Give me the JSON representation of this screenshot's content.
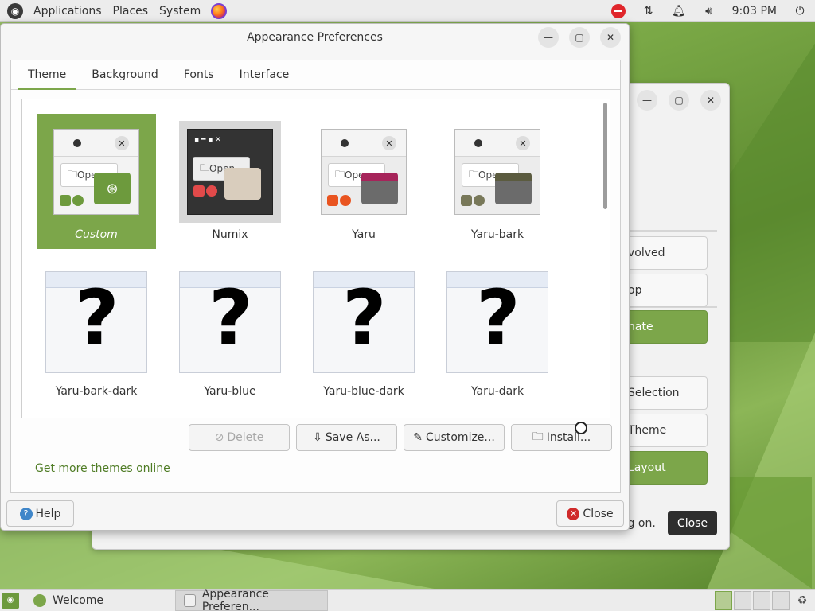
{
  "top_panel": {
    "menus": [
      "Applications",
      "Places",
      "System"
    ],
    "clock": "9:03 PM"
  },
  "dialog": {
    "title": "Appearance Preferences",
    "tabs": [
      "Theme",
      "Background",
      "Fonts",
      "Interface"
    ],
    "active_tab": "Theme",
    "themes": [
      {
        "name": "Custom",
        "style": "light",
        "accent": "#7ca64a",
        "selected": true
      },
      {
        "name": "Numix",
        "style": "dark",
        "accent": "#e24a4a",
        "selected": false
      },
      {
        "name": "Yaru",
        "style": "light",
        "accent": "#e95420",
        "selected": false
      },
      {
        "name": "Yaru-bark",
        "style": "light",
        "accent": "#787859",
        "selected": false
      },
      {
        "name": "Yaru-bark-dark",
        "style": "unknown",
        "selected": false
      },
      {
        "name": "Yaru-blue",
        "style": "unknown",
        "selected": false
      },
      {
        "name": "Yaru-blue-dark",
        "style": "unknown",
        "selected": false
      },
      {
        "name": "Yaru-dark",
        "style": "unknown",
        "selected": false
      }
    ],
    "preview_open_label": "Open",
    "unknown_preview_mark": "?",
    "actions": {
      "delete": "Delete",
      "save_as": "Save As...",
      "customize": "Customize...",
      "install": "Install..."
    },
    "more_link": "Get more themes online",
    "help": "Help",
    "close": "Close"
  },
  "background_window": {
    "side_buttons": [
      "volved",
      "op",
      "nate",
      "Selection",
      "Theme",
      "Layout"
    ],
    "logon_text": "og on.",
    "close": "Close"
  },
  "taskbar": {
    "tasks": [
      {
        "label": "Welcome",
        "active": false
      },
      {
        "label": "Appearance Preferen...",
        "active": true
      }
    ]
  },
  "colors": {
    "accent": "#7ca64a",
    "link": "#4f7c25",
    "dnd": "#e0262b"
  }
}
